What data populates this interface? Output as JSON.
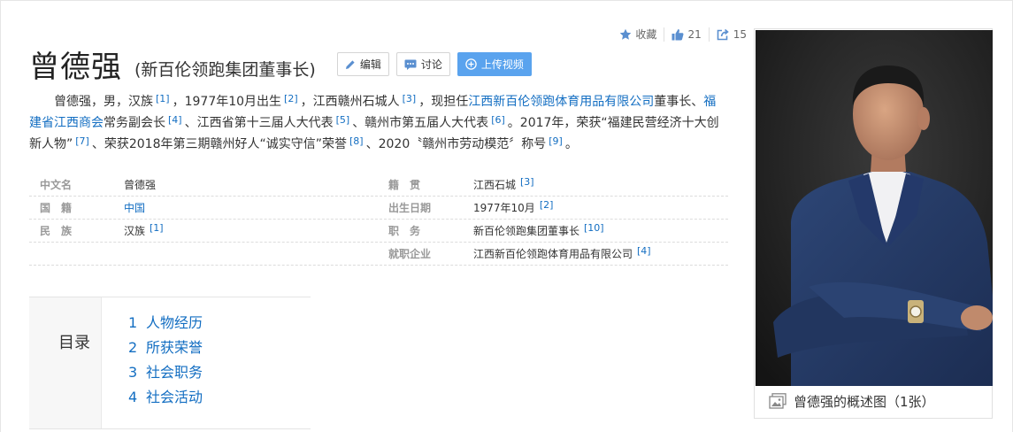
{
  "actions": {
    "favorite_label": "收藏",
    "like_count": "21",
    "share_count": "15"
  },
  "header": {
    "title": "曾德强",
    "subtitle": "(新百伦领跑集团董事长)",
    "edit_label": "编辑",
    "discuss_label": "讨论",
    "upload_label": "上传视频"
  },
  "summary": {
    "s1": "曾德强，男，汉族",
    "r1": "[1]",
    "s2": "，1977年10月出生",
    "r2": "[2]",
    "s3": "，江西赣州石城人",
    "r3": "[3]",
    "s4": "，现担任",
    "link1": "江西新百伦领跑体育用品有限公司",
    "s5": "董事长、",
    "link2": "福建省江西商会",
    "s6": "常务副会长",
    "r4": "[4]",
    "s7": "、江西省第十三届人大代表",
    "r5": "[5]",
    "s8": "、赣州市第五届人大代表",
    "r6": "[6]",
    "s9": "。2017年，荣获“福建民营经济十大创新人物”",
    "r7": "[7]",
    "s10": "、荣获2018年第三期赣州好人“诚实守信”荣誉",
    "r8": "[8]",
    "s11": "、2020〝赣州市劳动模范〞称号",
    "r9": "[9]",
    "s12": "。"
  },
  "infobox": {
    "chinese_name_label": "中文名",
    "chinese_name": "曾德强",
    "nationality_label": "国　籍",
    "nationality": "中国",
    "ethnicity_label": "民　族",
    "ethnicity": "汉族",
    "ethnicity_ref": "[1]",
    "native_place_label": "籍　贯",
    "native_place": "江西石城",
    "native_place_ref": "[3]",
    "birth_label": "出生日期",
    "birth": "1977年10月",
    "birth_ref": "[2]",
    "position_label": "职　务",
    "position": "新百伦领跑集团董事长",
    "position_ref": "[10]",
    "company_label": "就职企业",
    "company": "江西新百伦领跑体育用品有限公司",
    "company_ref": "[4]"
  },
  "toc": {
    "title": "目录",
    "items": [
      {
        "num": "1",
        "label": "人物经历"
      },
      {
        "num": "2",
        "label": "所获荣誉"
      },
      {
        "num": "3",
        "label": "社会职务"
      },
      {
        "num": "4",
        "label": "社会活动"
      }
    ]
  },
  "photo": {
    "caption": "曾德强的概述图（1张）"
  },
  "colors": {
    "link": "#136ec2",
    "upload_button": "#5aa3ee",
    "photo_bg": "#1e1e1e"
  },
  "icons": {
    "favorite": "star-icon",
    "like": "thumbs-up-icon",
    "share": "share-icon",
    "edit": "pencil-icon",
    "discuss": "chat-icon",
    "upload": "plus-circle-icon",
    "caption": "image-icon"
  }
}
